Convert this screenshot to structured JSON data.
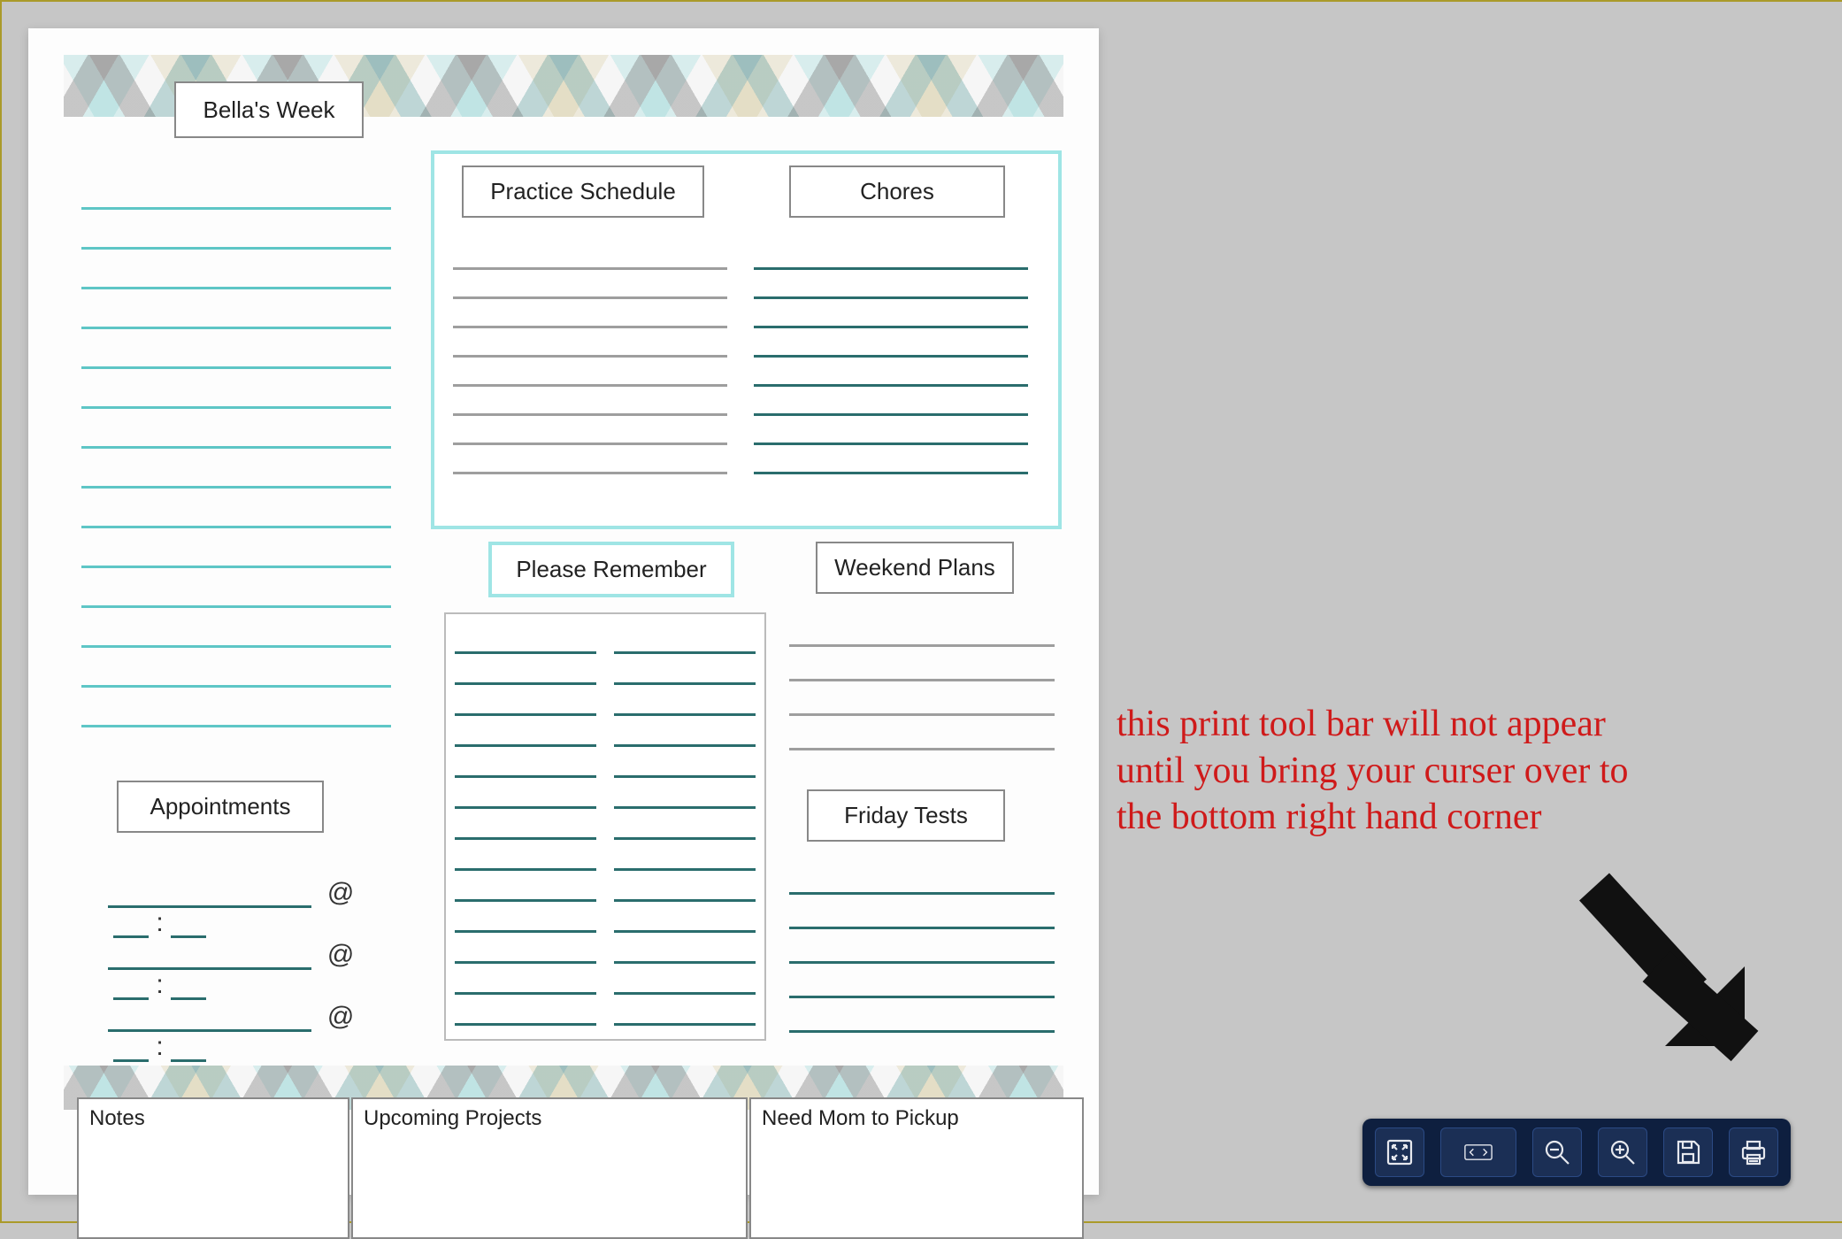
{
  "planner": {
    "title": "Bella's Week",
    "sections": {
      "practice": "Practice Schedule",
      "chores": "Chores",
      "remember": "Please Remember",
      "weekend": "Weekend Plans",
      "appointments": "Appointments",
      "friday": "Friday Tests",
      "notes": "Notes",
      "projects": "Upcoming Projects",
      "pickup": "Need Mom to Pickup"
    },
    "appointment_marker": "@",
    "appointment_colon": ":"
  },
  "annotation": {
    "line1": "this print tool bar will not appear",
    "line2": "until you bring your curser over to",
    "line3": "the bottom right hand corner"
  },
  "toolbar": {
    "fit_page": "Fit page",
    "fit_width": "Fit width",
    "zoom_out": "Zoom out",
    "zoom_in": "Zoom in",
    "save": "Save",
    "print": "Print"
  }
}
